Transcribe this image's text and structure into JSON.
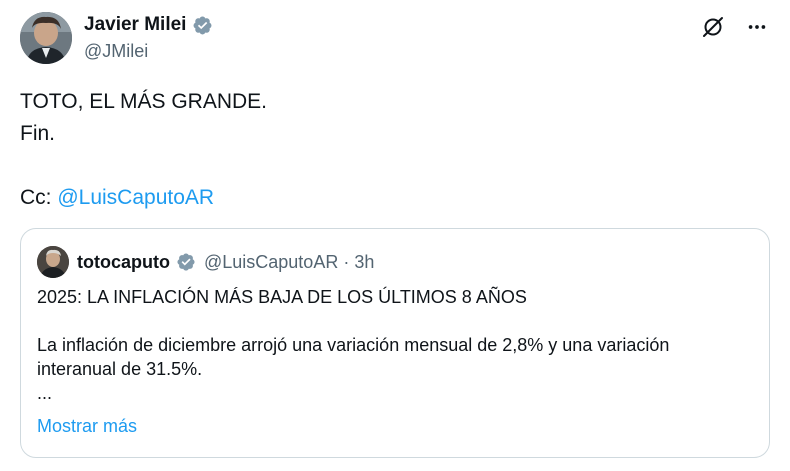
{
  "author": {
    "name": "Javier Milei",
    "handle": "@JMilei",
    "verified_color": "#829aab"
  },
  "tweet": {
    "line1": "TOTO, EL MÁS GRANDE.",
    "line2": "Fin.",
    "cc_prefix": "Cc: ",
    "cc_mention": "@LuisCaputoAR"
  },
  "icons": {
    "grok": "slash-circle-icon",
    "more": "more-icon"
  },
  "quoted": {
    "name": "totocaputo",
    "handle": "@LuisCaputoAR",
    "separator": "·",
    "time": "3h",
    "headline": "2025: LA INFLACIÓN MÁS BAJA DE LOS ÚLTIMOS 8 AÑOS",
    "paragraph_line1": "La inflación de diciembre arrojó una variación mensual de 2,8% y una variación",
    "paragraph_line2": "interanual de 31.5%.",
    "ellipsis": "...",
    "show_more": "Mostrar más"
  },
  "colors": {
    "link": "#1d9bf0",
    "secondary_text": "#536471",
    "border": "#cfd9de"
  }
}
